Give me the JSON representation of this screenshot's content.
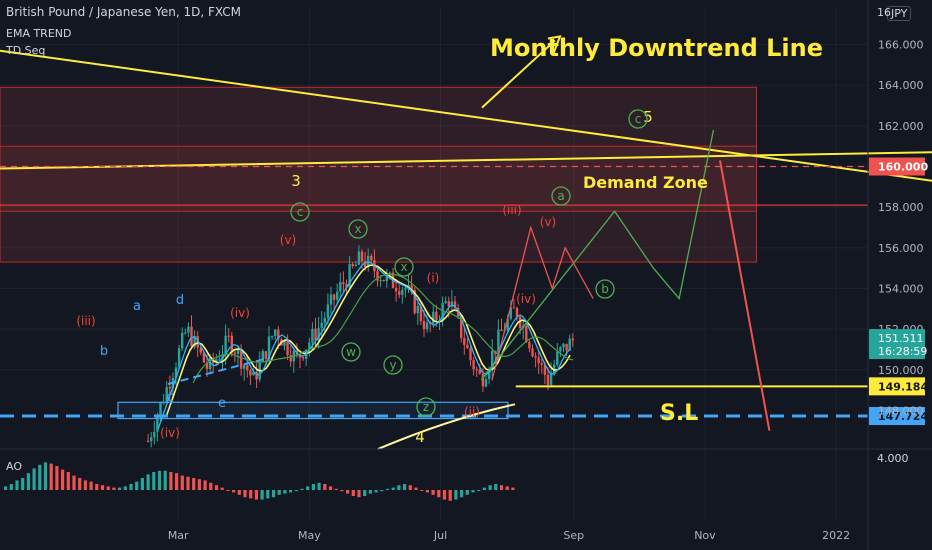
{
  "header": {
    "symbol": "British Pound / Japanese Yen, 1D, FXCM",
    "indicators": [
      "EMA TREND",
      "TD Seq"
    ],
    "currency": "JPY",
    "price_top_partial": "16"
  },
  "oscillator": {
    "name": "AO",
    "axis_value": "4.000"
  },
  "colors": {
    "background": "#131722",
    "up": "#26a69a",
    "down": "#ef5350",
    "yellow": "#ffeb3b",
    "blue": "#42a5f5",
    "wave_green": "#4caf50",
    "wave_red": "#f44336"
  },
  "chart_data": {
    "type": "line",
    "title": "British Pound / Japanese Yen, 1D, FXCM",
    "x_labels": [
      "Mar",
      "May",
      "Jul",
      "Sep",
      "Nov",
      "2022"
    ],
    "y_ticks": [
      150.0,
      152.0,
      154.0,
      156.0,
      158.0,
      160.0,
      162.0,
      164.0,
      166.0
    ],
    "y_tick_labels": [
      "150.000",
      "152.000",
      "154.000",
      "156.000",
      "158.000",
      "160.000",
      "162.000",
      "164.000",
      "166.000"
    ],
    "ylim": [
      146.2,
      167.8
    ],
    "price_path": {
      "x": [
        "2021-02-15",
        "2021-02-25",
        "2021-03-05",
        "2021-03-15",
        "2021-03-25",
        "2021-04-05",
        "2021-04-15",
        "2021-04-25",
        "2021-05-05",
        "2021-05-15",
        "2021-05-25",
        "2021-06-05",
        "2021-06-15",
        "2021-06-25",
        "2021-07-05",
        "2021-07-15",
        "2021-07-20",
        "2021-07-30",
        "2021-08-05",
        "2021-08-15",
        "2021-08-20",
        "2021-08-25",
        "2021-09-01"
      ],
      "y": [
        146.5,
        149.5,
        152.0,
        150.0,
        151.5,
        149.5,
        152.0,
        150.5,
        152.0,
        154.0,
        155.5,
        154.5,
        154.0,
        152.0,
        153.5,
        150.5,
        149.5,
        152.0,
        153.0,
        150.5,
        149.5,
        150.8,
        151.5
      ]
    },
    "projection_green": {
      "x": [
        "2021-07-20",
        "2021-09-20",
        "2021-10-08",
        "2021-10-20",
        "2021-11-05"
      ],
      "y": [
        149.5,
        157.8,
        155.0,
        153.5,
        161.8
      ]
    },
    "projection_red": {
      "x": [
        "2021-07-25",
        "2021-08-12",
        "2021-08-22",
        "2021-08-28",
        "2021-09-10"
      ],
      "y": [
        149.5,
        157.0,
        154.0,
        156.0,
        153.5
      ]
    },
    "stop_loss_drop": {
      "x": [
        "2021-11-08",
        "2021-12-01"
      ],
      "y": [
        160.3,
        147.0
      ]
    },
    "price_labels": {
      "last": "151.511",
      "countdown": "16:28:59",
      "level_yellow": "149.184",
      "level_blue": "147.724",
      "level_red": "160.000",
      "level_partial": "148.000"
    },
    "levels": {
      "resistance_red_dashed": 160.0,
      "support_yellow": 149.184,
      "stop_loss_blue_dashed": 147.724
    },
    "zones": [
      {
        "name": "Demand Zone",
        "from": 155.3,
        "to": 163.9,
        "x_start": "2021-01-01",
        "x_end": "2021-11-25"
      }
    ],
    "annotations": [
      "Monthly Downtrend Line",
      "Demand Zone",
      "S.L"
    ],
    "wave_labels": [
      "3",
      "4",
      "5",
      "(iii)",
      "(iv)",
      "(v)",
      "(i)",
      "(iii)",
      "(iv)",
      "(v)",
      "(ii)",
      "(iv)",
      "a",
      "b",
      "c",
      "d",
      "e",
      "c",
      "c",
      "x",
      "x",
      "w",
      "y",
      "z",
      "a",
      "b",
      "c"
    ],
    "ao_histogram": [
      0.3,
      0.5,
      0.8,
      1.0,
      1.4,
      1.8,
      2.1,
      2.3,
      2.2,
      2.0,
      1.7,
      1.5,
      1.2,
      1.0,
      0.8,
      0.7,
      0.5,
      0.4,
      0.3,
      0.2,
      0.2,
      0.3,
      0.5,
      0.7,
      1.0,
      1.3,
      1.5,
      1.6,
      1.6,
      1.5,
      1.4,
      1.2,
      1.1,
      1.0,
      0.9,
      0.8,
      0.6,
      0.4,
      0.2,
      0.0,
      -0.2,
      -0.4,
      -0.6,
      -0.7,
      -0.8,
      -0.8,
      -0.7,
      -0.6,
      -0.4,
      -0.3,
      -0.2,
      -0.1,
      0.1,
      0.3,
      0.5,
      0.6,
      0.5,
      0.3,
      0.1,
      -0.1,
      -0.3,
      -0.5,
      -0.6,
      -0.5,
      -0.3,
      -0.2,
      -0.1,
      0.1,
      0.2,
      0.4,
      0.5,
      0.4,
      0.2,
      0.0,
      -0.2,
      -0.4,
      -0.6,
      -0.8,
      -0.9,
      -0.8,
      -0.6,
      -0.4,
      -0.2,
      0.0,
      0.2,
      0.4,
      0.5,
      0.4,
      0.3,
      0.2
    ]
  }
}
